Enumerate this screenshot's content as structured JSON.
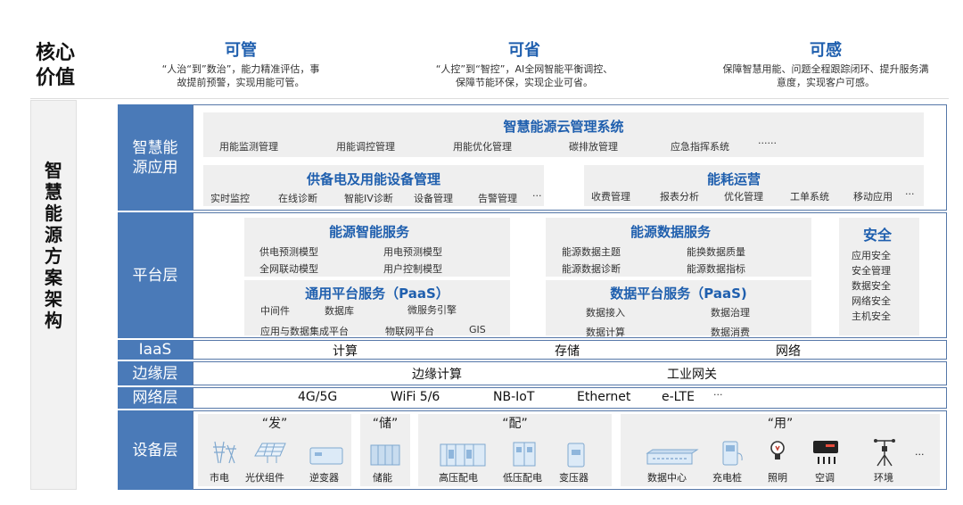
{
  "core": {
    "title_line1": "核心",
    "title_line2": "价值"
  },
  "values": [
    {
      "title": "可管",
      "desc1": "“人治“到”数治”，能力精准评估，事",
      "desc2": "故提前预警，实现用能可管。"
    },
    {
      "title": "可省",
      "desc1": "“人控”到“智控”，AI全网智能平衡调控、",
      "desc2": "保障节能环保，实现企业可省。"
    },
    {
      "title": "可感",
      "desc1": "保障智慧用能、问题全程跟踪闭环、提升服务满",
      "desc2": "意度，实现客户可感。"
    }
  ],
  "architecture_title": [
    "智",
    "慧",
    "能",
    "源",
    "方",
    "案",
    "架",
    "构"
  ],
  "layers": {
    "app": "智慧能源应用",
    "platform": "平台层",
    "iaas": "IaaS",
    "edge": "边缘层",
    "network": "网络层",
    "device": "设备层"
  },
  "app_layer": {
    "cloud": {
      "title": "智慧能源云管理系统",
      "items": [
        "用能监测管理",
        "用能调控管理",
        "用能优化管理",
        "碳排放管理",
        "应急指挥系统",
        "······"
      ]
    },
    "supply": {
      "title": "供备电及用能设备管理",
      "items": [
        "实时监控",
        "在线诊断",
        "智能IV诊断",
        "设备管理",
        "告警管理",
        "···"
      ]
    },
    "ops": {
      "title": "能耗运营",
      "items": [
        "收费管理",
        "报表分析",
        "优化管理",
        "工单系统",
        "移动应用",
        "···"
      ]
    }
  },
  "platform_layer": {
    "intelligent": {
      "title": "能源智能服务",
      "items": [
        "供电预测模型",
        "用电预测模型",
        "全网联动模型",
        "用户控制模型"
      ]
    },
    "data": {
      "title": "能源数据服务",
      "items": [
        "能源数据主题",
        "能换数据质量",
        "能源数据诊断",
        "能源数据指标"
      ]
    },
    "paas": {
      "title": "通用平台服务（PaaS）",
      "items": [
        "中间件",
        "数据库",
        "微服务引擎",
        "应用与数据集成平台",
        "物联网平台",
        "GIS"
      ]
    },
    "data_paas": {
      "title": "数据平台服务（PaaS)",
      "items": [
        "数据接入",
        "数据治理",
        "数据计算",
        "数据消费"
      ]
    },
    "security": {
      "title": "安全",
      "items": [
        "应用安全",
        "安全管理",
        "数据安全",
        "网络安全",
        "主机安全"
      ]
    }
  },
  "iaas_layer": {
    "items": [
      "计算",
      "存储",
      "网络"
    ]
  },
  "edge_layer": {
    "items": [
      "边缘计算",
      "工业网关"
    ]
  },
  "network_layer": {
    "items": [
      "4G/5G",
      "WiFi 5/6",
      "NB-IoT",
      "Ethernet",
      "e-LTE",
      "···"
    ]
  },
  "device_layer": {
    "groups": [
      "“发”",
      "“储”",
      "“配”",
      "“用”"
    ],
    "devices": [
      "市电",
      "光伏组件",
      "逆变器",
      "储能",
      "高压配电",
      "低压配电",
      "变压器",
      "数据中心",
      "充电桩",
      "照明",
      "空调",
      "环境",
      "···"
    ]
  },
  "colors": {
    "accent": "#1f5fae",
    "label_bg": "#4a7ab8",
    "frame": "#5577a8",
    "panel": "#efefef"
  }
}
